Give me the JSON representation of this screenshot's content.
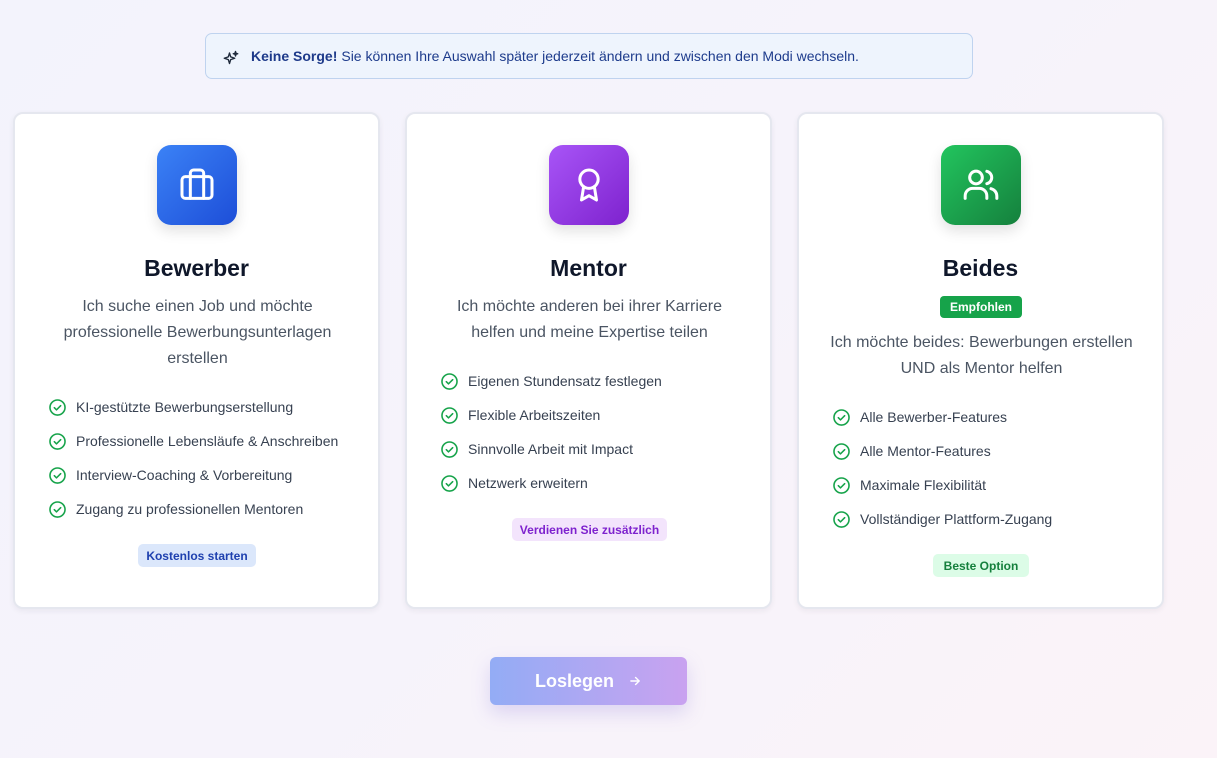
{
  "notice": {
    "bold": "Keine Sorge!",
    "text": "Sie können Ihre Auswahl später jederzeit ändern und zwischen den Modi wechseln.",
    "icon": "sparkles-icon"
  },
  "cards": [
    {
      "icon": "briefcase-icon",
      "title": "Bewerber",
      "description": "Ich suche einen Job und möchte professionelle Bewerbungsunterlagen erstellen",
      "features": [
        "KI-gestützte Bewerbungserstellung",
        "Professionelle Lebensläufe & Anschreiben",
        "Interview-Coaching & Vorbereitung",
        "Zugang zu professionellen Mentoren"
      ],
      "badge": "Kostenlos starten",
      "accent": "#2563eb"
    },
    {
      "icon": "award-icon",
      "title": "Mentor",
      "description": "Ich möchte anderen bei ihrer Karriere helfen und meine Expertise teilen",
      "features": [
        "Eigenen Stundensatz festlegen",
        "Flexible Arbeitszeiten",
        "Sinnvolle Arbeit mit Impact",
        "Netzwerk erweitern"
      ],
      "badge": "Verdienen Sie zusätzlich",
      "accent": "#9333ea"
    },
    {
      "icon": "users-icon",
      "title": "Beides",
      "recommended": "Empfohlen",
      "description": "Ich möchte beides: Bewerbungen erstellen UND als Mentor helfen",
      "features": [
        "Alle Bewerber-Features",
        "Alle Mentor-Features",
        "Maximale Flexibilität",
        "Vollständiger Plattform-Zugang"
      ],
      "badge": "Beste Option",
      "accent": "#16a34a"
    }
  ],
  "cta": {
    "label": "Loslegen",
    "icon": "arrow-right-icon"
  },
  "colors": {
    "check": "#16a34a"
  }
}
